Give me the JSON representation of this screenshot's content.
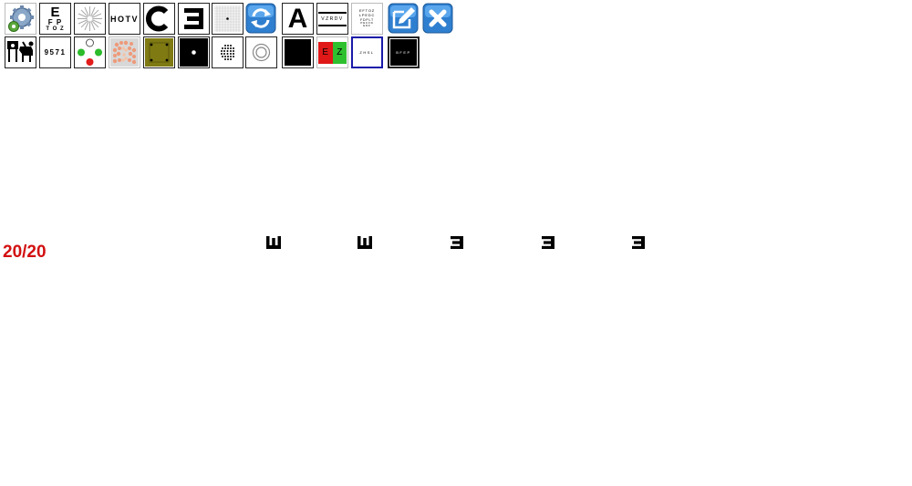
{
  "toolbar": {
    "row1": [
      {
        "name": "settings-gears-icon"
      },
      {
        "name": "snellen-chart-icon",
        "lines": [
          "E",
          "F P",
          "T O Z"
        ]
      },
      {
        "name": "astigmatism-dial-icon"
      },
      {
        "name": "hotv-chart-icon",
        "text": "HOTV"
      },
      {
        "name": "landolt-c-icon"
      },
      {
        "name": "tumbling-e-icon"
      },
      {
        "name": "amsler-grid-icon"
      },
      {
        "name": "refresh-cycle-icon"
      },
      {
        "name": "single-letter-icon",
        "text": "A"
      },
      {
        "name": "letter-line-icon",
        "text": "VZRDV"
      },
      {
        "name": "mini-chart-icon",
        "lines": [
          "EFTOZ",
          "LPEDC",
          "FDPLT",
          "PECFD",
          "EDF"
        ]
      },
      {
        "name": "edit-icon"
      },
      {
        "name": "close-icon"
      }
    ],
    "row2": [
      {
        "name": "pediatric-pictures-icon"
      },
      {
        "name": "number-chart-icon",
        "text": "9571"
      },
      {
        "name": "worth-four-dot-icon"
      },
      {
        "name": "color-vision-plate-icon"
      },
      {
        "name": "fixation-dots-icon"
      },
      {
        "name": "black-dot-icon"
      },
      {
        "name": "dot-pattern-icon"
      },
      {
        "name": "target-circle-icon"
      },
      {
        "name": "black-screen-icon"
      },
      {
        "name": "red-green-duochrome-icon",
        "letters": [
          "E",
          "Z"
        ]
      },
      {
        "name": "small-letters-white-icon",
        "text": "ZHSL"
      },
      {
        "name": "small-letters-black-icon",
        "text": "BFEP"
      }
    ]
  },
  "display": {
    "acuity_label": "20/20",
    "acuity_color": "#d21010",
    "optotype_directions": [
      "up",
      "up",
      "left",
      "left",
      "left"
    ]
  }
}
